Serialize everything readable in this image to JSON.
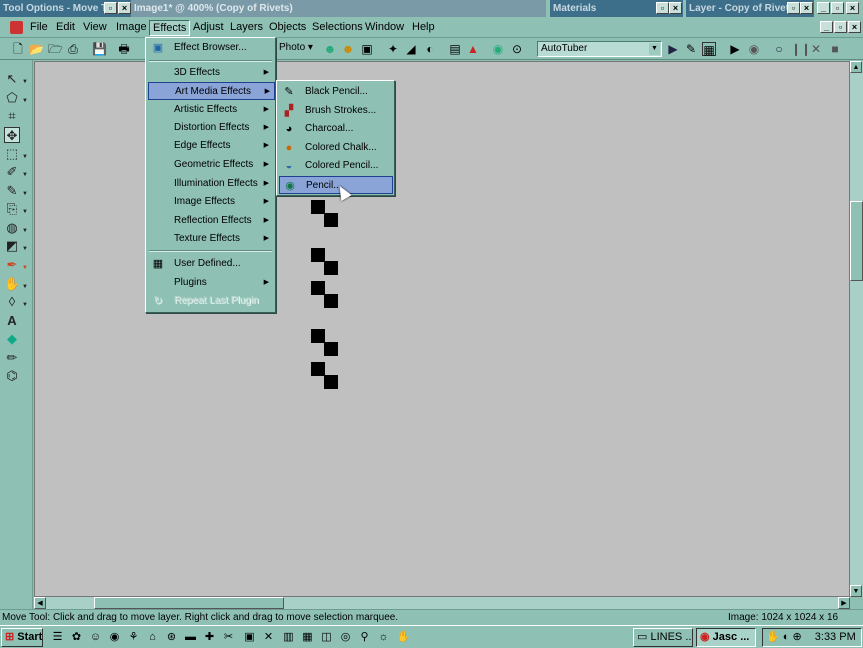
{
  "windows": {
    "tool_options_title": "Tool Options - Move T...",
    "image_title": "Image1* @ 400% (Copy of Rivets)",
    "materials_title": "Materials",
    "layer_title": "Layer - Copy of Rivets"
  },
  "menubar": {
    "items": [
      "File",
      "Edit",
      "View",
      "Image",
      "Effects",
      "Adjust",
      "Layers",
      "Objects",
      "Selections",
      "Window",
      "Help"
    ],
    "open_item": "Effects"
  },
  "toolbar": {
    "photo_combo": "Photo",
    "script_combo": "AutoTuber"
  },
  "effects_menu": {
    "items": [
      {
        "label": "Effect Browser...",
        "icon": "effect-browser-icon"
      },
      {
        "label": "3D Effects",
        "submenu": true
      },
      {
        "label": "Art Media Effects",
        "submenu": true,
        "highlighted": true
      },
      {
        "label": "Artistic Effects",
        "submenu": true
      },
      {
        "label": "Distortion Effects",
        "submenu": true
      },
      {
        "label": "Edge Effects",
        "submenu": true
      },
      {
        "label": "Geometric Effects",
        "submenu": true
      },
      {
        "label": "Illumination Effects",
        "submenu": true
      },
      {
        "label": "Image Effects",
        "submenu": true
      },
      {
        "label": "Reflection Effects",
        "submenu": true
      },
      {
        "label": "Texture Effects",
        "submenu": true
      },
      {
        "label": "User Defined...",
        "icon": "grid-icon"
      },
      {
        "label": "Plugins",
        "submenu": true
      },
      {
        "label": "Repeat Last Plugin",
        "disabled": true,
        "icon": "repeat-icon"
      }
    ]
  },
  "art_media_submenu": {
    "items": [
      {
        "label": "Black Pencil...",
        "icon": "black-pencil-icon"
      },
      {
        "label": "Brush Strokes...",
        "icon": "brush-strokes-icon"
      },
      {
        "label": "Charcoal...",
        "icon": "charcoal-icon"
      },
      {
        "label": "Colored Chalk...",
        "icon": "colored-chalk-icon"
      },
      {
        "label": "Colored Pencil...",
        "icon": "colored-pencil-icon"
      },
      {
        "label": "Pencil...",
        "icon": "pencil-icon",
        "highlighted": true
      }
    ]
  },
  "statusbar": {
    "message": "Move Tool: Click and drag to move layer. Right click and drag to move selection marquee.",
    "image_info": "Image:  1024 x 1024 x 16 million"
  },
  "taskbar": {
    "start_label": "Start",
    "tasks": [
      "LINES ...",
      "Jasc ..."
    ],
    "clock": "3:33 PM"
  },
  "colors": {
    "chrome": "#8fc0b4",
    "canvas": "#c0c0c0",
    "highlight": "#8aa4d8",
    "titlebar": "#3e6f8a"
  }
}
